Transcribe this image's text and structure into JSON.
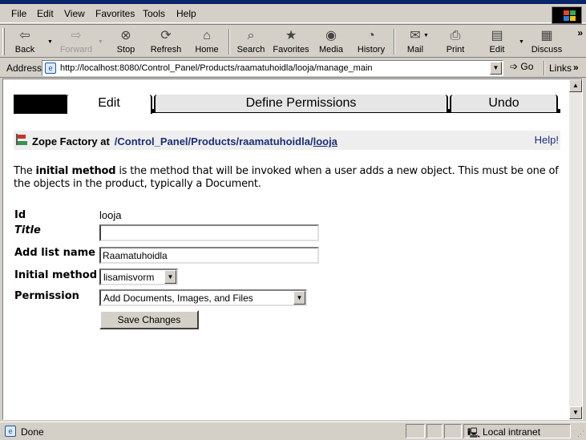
{
  "menu": {
    "file": "File",
    "edit": "Edit",
    "view": "View",
    "favorites": "Favorites",
    "tools": "Tools",
    "help": "Help"
  },
  "toolbar": {
    "back": "Back",
    "forward": "Forward",
    "stop": "Stop",
    "refresh": "Refresh",
    "home": "Home",
    "search": "Search",
    "favorites": "Favorites",
    "media": "Media",
    "history": "History",
    "mail": "Mail",
    "print": "Print",
    "edit": "Edit",
    "discuss": "Discuss"
  },
  "addressbar": {
    "label": "Address",
    "url": "http://localhost:8080/Control_Panel/Products/raamatuhoidla/looja/manage_main",
    "go": "Go",
    "links": "Links"
  },
  "tabs": [
    {
      "label": "Edit",
      "active": true
    },
    {
      "label": "Define Permissions",
      "active": false
    },
    {
      "label": "Undo",
      "active": false
    }
  ],
  "header": {
    "prefix": "Zope Factory at",
    "path_plain": "/Control_Panel/Products/raamatuhoidla/",
    "path_link": "looja",
    "help": "Help!"
  },
  "description": {
    "part1": "The ",
    "bold": "initial method",
    "part2": " is the method that will be invoked when a user adds a new object. This must be one of the objects in the product, typically a Document."
  },
  "form": {
    "id_label": "Id",
    "id_value": "looja",
    "title_label": "Title",
    "title_value": "",
    "add_list_label": "Add list name",
    "add_list_value": "Raamatuhoidla",
    "initial_method_label": "Initial method",
    "initial_method_value": "lisamisvorm",
    "permission_label": "Permission",
    "permission_value": "Add Documents, Images, and Files",
    "save_label": "Save Changes"
  },
  "status": {
    "text": "Done",
    "zone": "Local intranet"
  }
}
